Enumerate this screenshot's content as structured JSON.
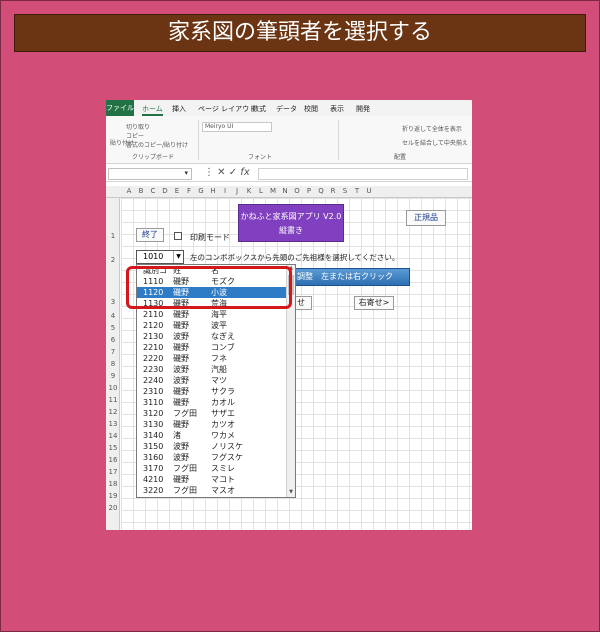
{
  "banner": {
    "title": "家系図の筆頭者を選択する"
  },
  "ribbon": {
    "tabs": [
      "ファイル",
      "ホーム",
      "挿入",
      "ページ レイアウト",
      "数式",
      "データ",
      "校閲",
      "表示",
      "開発"
    ],
    "paste_label": "貼り付け",
    "cut_label": "切り取り",
    "copy_label": "コピー",
    "format_painter_label": "書式のコピー/貼り付け",
    "clipboard_group": "クリップボード",
    "font_name": "Meiryo UI",
    "font_group": "フォント",
    "wrap_label": "折り返して全体を表示",
    "merge_label": "セルを結合して中央揃え",
    "align_group": "配置"
  },
  "formula_bar": {
    "fx": "fx"
  },
  "columns": [
    "A",
    "B",
    "C",
    "D",
    "E",
    "F",
    "G",
    "H",
    "I",
    "J",
    "K",
    "L",
    "M",
    "N",
    "O",
    "P",
    "Q",
    "R",
    "S",
    "T",
    "U"
  ],
  "rows": [
    "1",
    "2",
    "3",
    "4",
    "5",
    "6",
    "7",
    "8",
    "9",
    "10",
    "11",
    "12",
    "13",
    "14",
    "15",
    "16",
    "17",
    "18",
    "19",
    "20"
  ],
  "sheet": {
    "app_title": "かねふと家系図アプリ V2.0",
    "app_subtitle": "縦書き",
    "regular_button": "正規品",
    "exit_button": "終了",
    "print_mode": "印刷モード",
    "combo_value": "1010",
    "instruction": "左のコンボボックスから先頭のご先祖様を選択してください。",
    "adjust_button": "調整　左または右クリック",
    "right_button": "右寄せ>",
    "left_button_partial": "せ"
  },
  "dropdown": {
    "headers": [
      "識別コ",
      "姓",
      "名"
    ],
    "items": [
      {
        "code": "1110",
        "sei": "磯野",
        "mei": "モズク"
      },
      {
        "code": "1120",
        "sei": "磯野",
        "mei": "小波"
      },
      {
        "code": "1130",
        "sei": "磯野",
        "mei": "荒海"
      },
      {
        "code": "2110",
        "sei": "磯野",
        "mei": "海平"
      },
      {
        "code": "2120",
        "sei": "磯野",
        "mei": "波平"
      },
      {
        "code": "2130",
        "sei": "波野",
        "mei": "なぎえ"
      },
      {
        "code": "2210",
        "sei": "磯野",
        "mei": "コンブ"
      },
      {
        "code": "2220",
        "sei": "磯野",
        "mei": "フネ"
      },
      {
        "code": "2230",
        "sei": "波野",
        "mei": "汽船"
      },
      {
        "code": "2240",
        "sei": "波野",
        "mei": "マツ"
      },
      {
        "code": "2310",
        "sei": "磯野",
        "mei": "サクラ"
      },
      {
        "code": "3110",
        "sei": "磯野",
        "mei": "カオル"
      },
      {
        "code": "3120",
        "sei": "フグ田",
        "mei": "サザエ"
      },
      {
        "code": "3130",
        "sei": "磯野",
        "mei": "カツオ"
      },
      {
        "code": "3140",
        "sei": "渚",
        "mei": "ワカメ"
      },
      {
        "code": "3150",
        "sei": "波野",
        "mei": "ノリスケ"
      },
      {
        "code": "3160",
        "sei": "波野",
        "mei": "フグスケ"
      },
      {
        "code": "3170",
        "sei": "フグ田",
        "mei": "スミレ"
      },
      {
        "code": "4210",
        "sei": "磯野",
        "mei": "マコト"
      },
      {
        "code": "3220",
        "sei": "フグ田",
        "mei": "マスオ"
      }
    ],
    "selected_index": 1
  },
  "colors": {
    "background": "#d24d77",
    "banner": "#6b3412",
    "app_button": "#8040bf",
    "selection": "#2e7bc6",
    "highlight": "#d4171c"
  },
  "icons": [
    "checkbox-icon",
    "dropdown-arrow-icon",
    "scroll-up-icon",
    "scroll-down-icon"
  ]
}
